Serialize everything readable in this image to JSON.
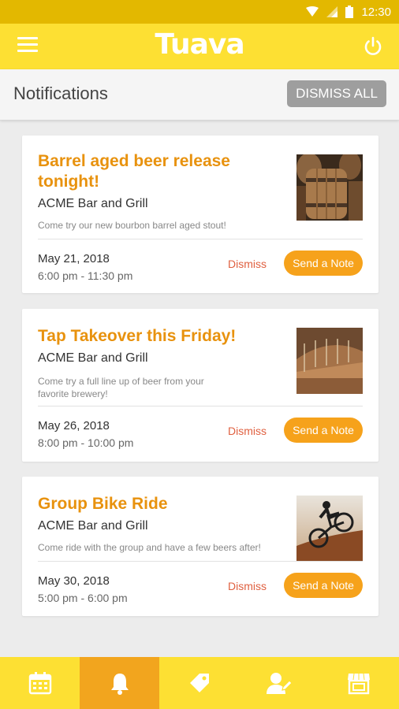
{
  "status_bar": {
    "time": "12:30"
  },
  "app_bar": {
    "logo": "Tuava",
    "menu_icon": "hamburger-menu-icon",
    "power_icon": "power-icon"
  },
  "header": {
    "title": "Notifications",
    "dismiss_all_label": "DISMISS ALL"
  },
  "notifications": [
    {
      "title": "Barrel aged beer release tonight!",
      "venue": "ACME Bar and Grill",
      "description": "Come try our new bourbon barrel aged stout!",
      "date": "May 21, 2018",
      "time": "6:00 pm - 11:30 pm",
      "dismiss_label": "Dismiss",
      "note_label": "Send a Note",
      "image": "barrels-photo"
    },
    {
      "title": "Tap Takeover this Friday!",
      "venue": "ACME Bar and Grill",
      "description": "Come try a full line up of beer from your favorite brewery!",
      "date": "May 26, 2018",
      "time": "8:00 pm - 10:00 pm",
      "dismiss_label": "Dismiss",
      "note_label": "Send a Note",
      "image": "tap-bar-photo"
    },
    {
      "title": "Group Bike Ride",
      "venue": "ACME Bar and Grill",
      "description": "Come ride with the group and have a few beers after!",
      "date": "May 30, 2018",
      "time": "5:00 pm - 6:00 pm",
      "dismiss_label": "Dismiss",
      "note_label": "Send a Note",
      "image": "mountain-bike-photo"
    }
  ],
  "bottom_nav": {
    "items": [
      {
        "icon": "calendar-icon",
        "active": false
      },
      {
        "icon": "bell-icon",
        "active": true
      },
      {
        "icon": "tag-icon",
        "active": false
      },
      {
        "icon": "user-profile-icon",
        "active": false
      },
      {
        "icon": "storefront-icon",
        "active": false
      }
    ]
  },
  "colors": {
    "status_bar": "#e3b800",
    "app_bar": "#fde033",
    "accent_orange": "#f6a21b",
    "title_orange": "#e8920e",
    "dismiss_red": "#e06040",
    "active_nav": "#f2a51e"
  }
}
